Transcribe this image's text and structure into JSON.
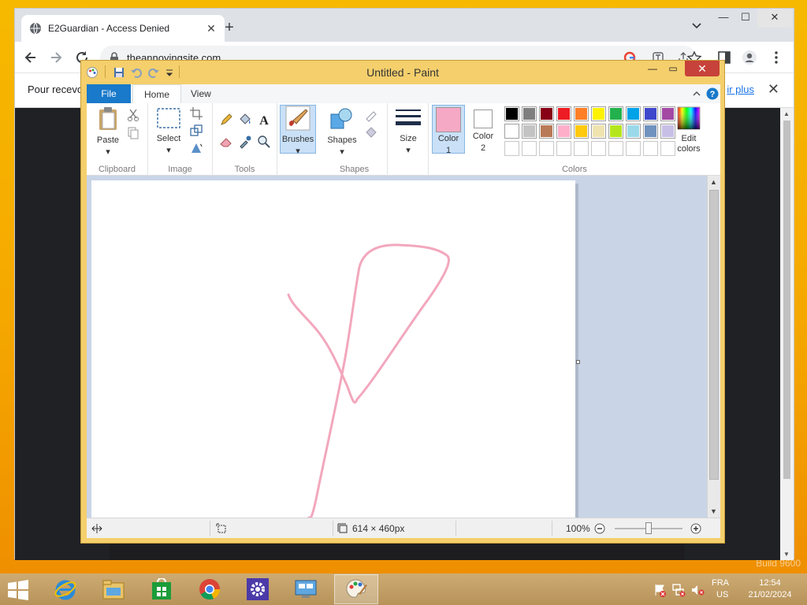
{
  "browser": {
    "tab_title": "E2Guardian - Access Denied",
    "url": "theannoyingsite.com",
    "infobar_text": "Pour recevo",
    "infobar_link": "ir plus"
  },
  "paint": {
    "title": "Untitled - Paint",
    "tabs": {
      "file": "File",
      "home": "Home",
      "view": "View"
    },
    "groups": {
      "clipboard": "Clipboard",
      "image": "Image",
      "tools": "Tools",
      "shapes": "Shapes",
      "colors": "Colors"
    },
    "buttons": {
      "paste": "Paste",
      "select": "Select",
      "brushes": "Brushes",
      "shapes": "Shapes",
      "size": "Size",
      "color1": "Color",
      "color1_num": "1",
      "color2": "Color",
      "color2_num": "2",
      "edit_colors": "Edit",
      "edit_colors2": "colors"
    },
    "active_color1": "#f5a9c4",
    "active_color2": "#ffffff",
    "palette": [
      [
        "#000000",
        "#7f7f7f",
        "#880015",
        "#ed1c24",
        "#ff7f27",
        "#fff200",
        "#22b14c",
        "#00a2e8",
        "#3f48cc",
        "#a349a4"
      ],
      [
        "#ffffff",
        "#c3c3c3",
        "#b97a57",
        "#ffaec9",
        "#ffc90e",
        "#efe4b0",
        "#b5e61d",
        "#99d9ea",
        "#7092be",
        "#c8bfe7"
      ],
      [
        "#ffffff",
        "#ffffff",
        "#ffffff",
        "#ffffff",
        "#ffffff",
        "#ffffff",
        "#ffffff",
        "#ffffff",
        "#ffffff",
        "#ffffff"
      ]
    ],
    "status": {
      "canvas_size": "614 × 460px",
      "zoom": "100%"
    }
  },
  "taskbar": {
    "lang_top": "FRA",
    "lang_bottom": "US",
    "time": "12:54",
    "date": "21/02/2024"
  }
}
